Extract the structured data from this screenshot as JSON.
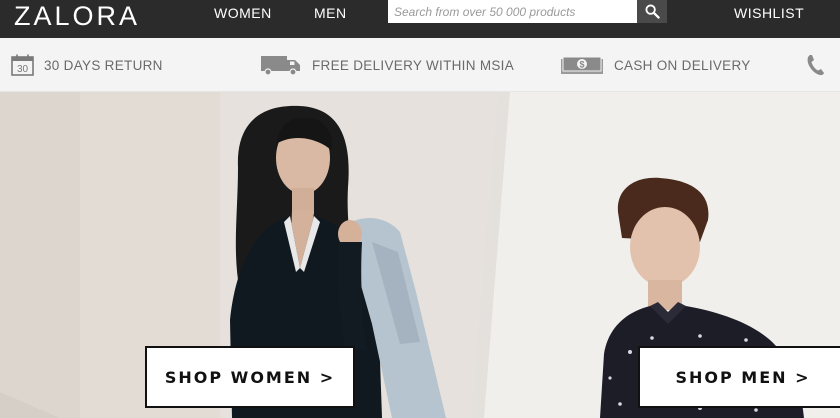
{
  "header": {
    "logo": "ZALORA",
    "nav": {
      "women": "WOMEN",
      "men": "MEN",
      "wishlist": "WISHLIST"
    },
    "search": {
      "placeholder": "Search from over 50 000 products",
      "icon": "search-icon"
    }
  },
  "usp": [
    {
      "icon": "calendar-icon",
      "icon_text": "30",
      "label": "30 DAYS RETURN"
    },
    {
      "icon": "delivery-truck-icon",
      "label": "FREE DELIVERY WITHIN MSIA"
    },
    {
      "icon": "cash-icon",
      "icon_text": "$",
      "label": "CASH ON DELIVERY"
    },
    {
      "icon": "phone-icon",
      "label": ""
    }
  ],
  "hero": {
    "women_cta": "SHOP WOMEN >",
    "men_cta": "SHOP MEN >"
  },
  "colors": {
    "topbar": "#2b2b2b",
    "usp_bg": "#f4f4f4",
    "usp_text": "#6a6a6a",
    "cta_border": "#111111"
  }
}
